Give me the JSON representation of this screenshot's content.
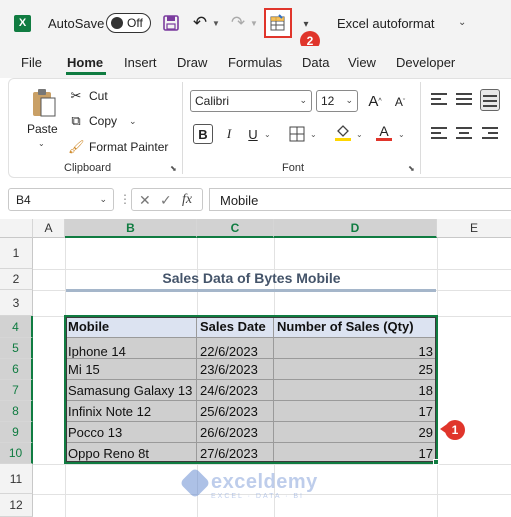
{
  "titlebar": {
    "app_icon": "X",
    "autosave_label": "AutoSave",
    "autosave_state": "Off",
    "doc_title": "Excel autoformat",
    "step_badge": "2"
  },
  "tabs": [
    "File",
    "Home",
    "Insert",
    "Draw",
    "Formulas",
    "Data",
    "View",
    "Developer"
  ],
  "ribbon": {
    "clipboard": {
      "paste": "Paste",
      "cut": "Cut",
      "copy": "Copy",
      "format_painter": "Format Painter",
      "group_label": "Clipboard"
    },
    "font": {
      "font_name": "Calibri",
      "font_size": "12",
      "bold": "B",
      "italic": "I",
      "underline": "U",
      "font_color_letter": "A",
      "grow": "A",
      "shrink": "A",
      "group_label": "Font"
    }
  },
  "formula_bar": {
    "name_box": "B4",
    "fx": "fx",
    "content": "Mobile"
  },
  "sheet": {
    "columns": [
      "A",
      "B",
      "C",
      "D",
      "E"
    ],
    "rows": [
      "1",
      "2",
      "3",
      "4",
      "5",
      "6",
      "7",
      "8",
      "9",
      "10",
      "11",
      "12"
    ],
    "title": "Sales Data of Bytes Mobile",
    "headers": [
      "Mobile",
      "Sales Date",
      "Number of Sales (Qty)"
    ],
    "data": [
      [
        "Iphone 14",
        "22/6/2023",
        "13"
      ],
      [
        "Mi 15",
        "23/6/2023",
        "25"
      ],
      [
        "Samasung Galaxy 13",
        "24/6/2023",
        "18"
      ],
      [
        "Infinix Note 12",
        "25/6/2023",
        "17"
      ],
      [
        "Pocco 13",
        "26/6/2023",
        "29"
      ],
      [
        "Oppo Reno 8t",
        "27/6/2023",
        "17"
      ]
    ],
    "step_badge": "1"
  },
  "watermark": {
    "name": "exceldemy",
    "tagline": "EXCEL · DATA · BI"
  },
  "colors": {
    "excel_green": "#107c41",
    "highlight_red": "#e0352b",
    "header_fill": "#dce3f1",
    "body_fill": "#cfcfcf",
    "title_text": "#44546a"
  }
}
